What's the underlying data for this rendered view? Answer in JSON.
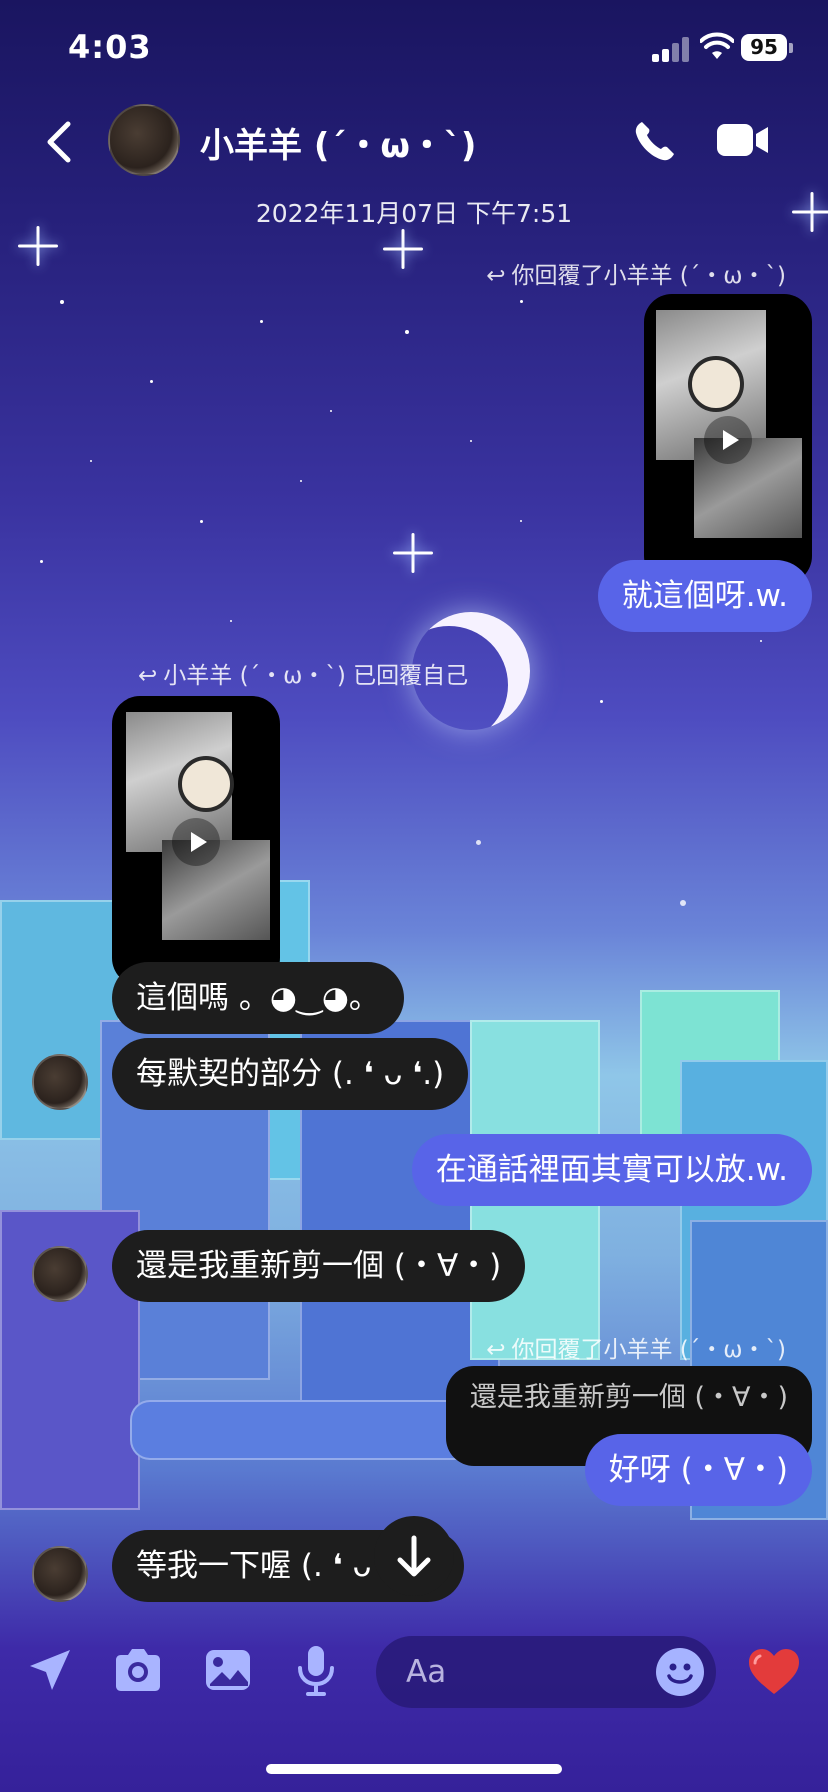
{
  "status_bar": {
    "time": "4:03",
    "battery": "95"
  },
  "header": {
    "contact_name": "小羊羊 (´・ω・`)"
  },
  "conversation": {
    "timestamp": "2022年11月07日 下午7:51",
    "reply_note_1": "你回覆了小羊羊 (´・ω・`)",
    "msg_out_1": "就這個呀.w.",
    "reply_note_2": "小羊羊 (´・ω・`) 已回覆自己",
    "msg_in_1": "這個嗎 。◕‿◕。",
    "msg_in_2": "每默契的部分 (. ❛ ᴗ ❛.)",
    "msg_out_2": "在通話裡面其實可以放.w.",
    "msg_in_3": "還是我重新剪一個 (・∀・)",
    "reply_note_3": "你回覆了小羊羊 (´・ω・`)",
    "quoted_text": "還是我重新剪一個 (・∀・)",
    "msg_out_3": "好呀 (・∀・)",
    "msg_in_4": "等我一下喔 (. ❛ ᴗ ❛."
  },
  "composer": {
    "placeholder": "Aa"
  },
  "icons": [
    "back-icon",
    "phone-icon",
    "video-icon",
    "reply-icon",
    "play-icon",
    "arrow-down-icon",
    "location-icon",
    "camera-icon",
    "gallery-icon",
    "mic-icon",
    "emoji-icon",
    "heart-icon"
  ],
  "colors": {
    "outgoing_bubble": "#5864e8",
    "incoming_bubble": "#1d1d1d",
    "heart": "#e33b3b"
  }
}
